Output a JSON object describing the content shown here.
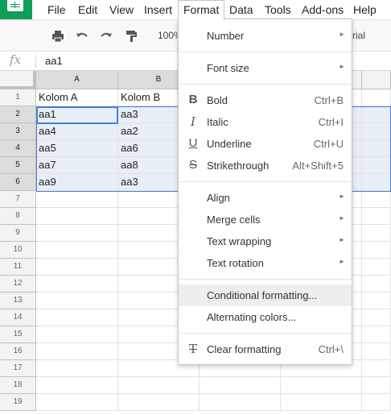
{
  "menubar": {
    "items": [
      "File",
      "Edit",
      "View",
      "Insert",
      "Format",
      "Data",
      "Tools",
      "Add-ons",
      "Help"
    ],
    "active": "Format"
  },
  "toolbar": {
    "zoom": "100%",
    "font_fragment": "rial",
    "icons": [
      "print-icon",
      "undo-icon",
      "redo-icon",
      "paint-format-icon"
    ]
  },
  "formula_bar": {
    "fx": "fx",
    "value": "aa1"
  },
  "grid": {
    "columns": [
      "A",
      "B"
    ],
    "rows": [
      "1",
      "2",
      "3",
      "4",
      "5",
      "6",
      "7",
      "8",
      "9",
      "10",
      "11",
      "12",
      "13",
      "14",
      "15",
      "16",
      "17",
      "18",
      "19"
    ],
    "cells": [
      [
        "Kolom A",
        "Kolom B"
      ],
      [
        "aa1",
        "aa3"
      ],
      [
        "aa4",
        "aa2"
      ],
      [
        "aa5",
        "aa6"
      ],
      [
        "aa7",
        "aa8"
      ],
      [
        "aa9",
        "aa3"
      ]
    ]
  },
  "format_menu": {
    "items": [
      {
        "label": "Number",
        "submenu": true
      },
      {
        "label": "Font size",
        "submenu": true
      },
      {
        "label": "Bold",
        "shortcut": "Ctrl+B",
        "icon": "bold-icon"
      },
      {
        "label": "Italic",
        "shortcut": "Ctrl+I",
        "icon": "italic-icon"
      },
      {
        "label": "Underline",
        "shortcut": "Ctrl+U",
        "icon": "underline-icon"
      },
      {
        "label": "Strikethrough",
        "shortcut": "Alt+Shift+5",
        "icon": "strikethrough-icon"
      },
      {
        "label": "Align",
        "submenu": true
      },
      {
        "label": "Merge cells",
        "submenu": true
      },
      {
        "label": "Text wrapping",
        "submenu": true
      },
      {
        "label": "Text rotation",
        "submenu": true
      },
      {
        "label": "Conditional formatting...",
        "highlighted": true
      },
      {
        "label": "Alternating colors..."
      },
      {
        "label": "Clear formatting",
        "shortcut": "Ctrl+\\",
        "icon": "clear-formatting-icon"
      }
    ],
    "arrow": "►",
    "icon_glyphs": {
      "bold": "B",
      "italic": "I",
      "underline": "U",
      "strikethrough": "S",
      "clear": "T"
    }
  },
  "colors": {
    "brand": "#0f9d58",
    "selection_border": "#4a7bd4",
    "selection_fill": "#e8eef8"
  }
}
